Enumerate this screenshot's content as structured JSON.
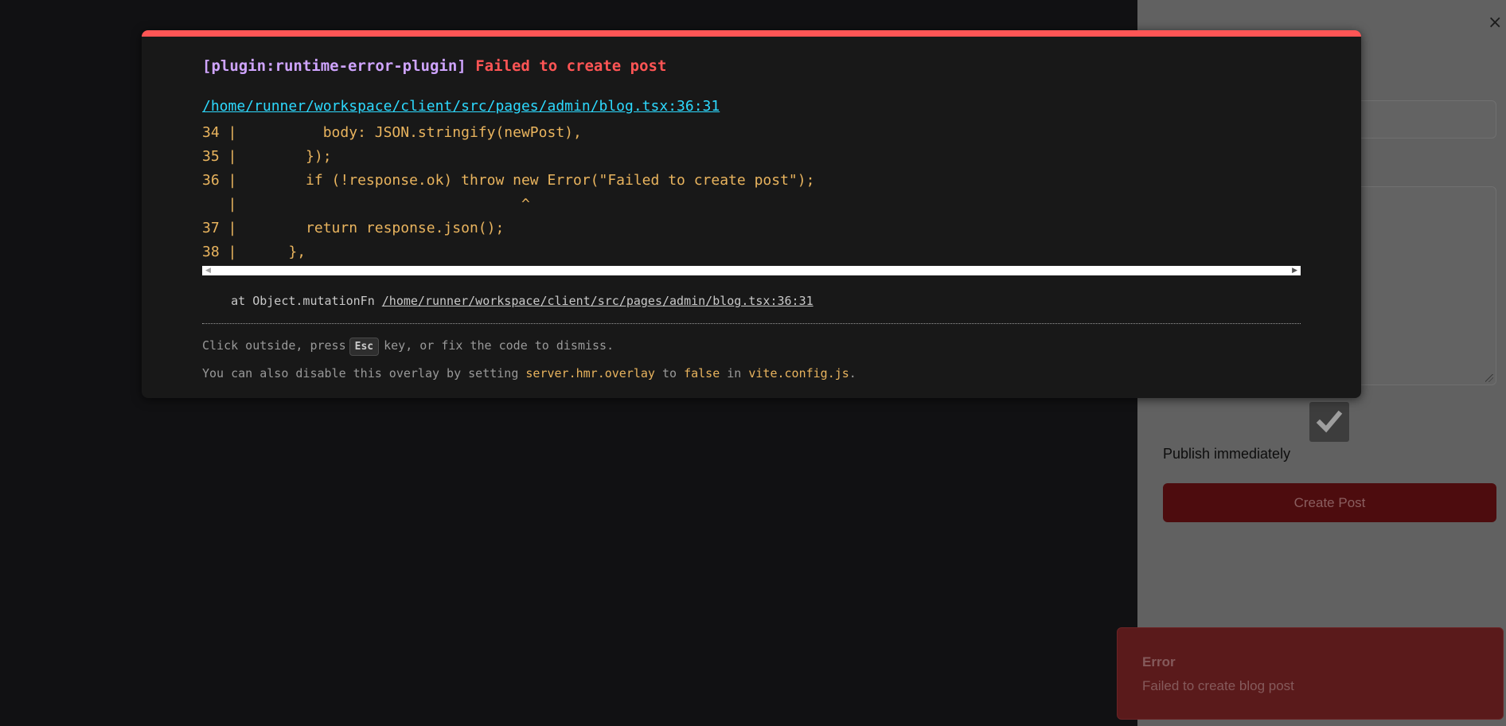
{
  "side_panel": {
    "close_glyph": "×",
    "publish_label": "Publish immediately",
    "create_button": "Create Post"
  },
  "toast": {
    "title": "Error",
    "description": "Failed to create blog post"
  },
  "overlay": {
    "plugin": "[plugin:runtime-error-plugin]",
    "message": "Failed to create post",
    "file": "/home/runner/workspace/client/src/pages/admin/blog.tsx:36:31",
    "frame_lines": [
      "34 |          body: JSON.stringify(newPost),",
      "35 |        });",
      "36 |        if (!response.ok) throw new Error(\"Failed to create post\");",
      "   |                                 ^",
      "37 |        return response.json();",
      "38 |      },"
    ],
    "stack_prefix": "    at Object.mutationFn ",
    "stack_link": "/home/runner/workspace/client/src/pages/admin/blog.tsx:36:31",
    "tip1_before": "Click outside, press",
    "tip1_key": "Esc",
    "tip1_after": "key, or fix the code to dismiss.",
    "tip2_a": "You can also disable this overlay by setting ",
    "tip2_code1": "server.hmr.overlay",
    "tip2_b": " to ",
    "tip2_code2": "false",
    "tip2_c": " in ",
    "tip2_code3": "vite.config.js",
    "tip2_d": "."
  },
  "colors": {
    "accent_error": "#ff5555",
    "link": "#2dd9fe",
    "code": "#e9b45e"
  },
  "icons": {
    "close": "close-icon",
    "checkbox": "checkmark-icon",
    "scroll_left": "arrow-left-icon",
    "scroll_right": "arrow-right-icon"
  }
}
